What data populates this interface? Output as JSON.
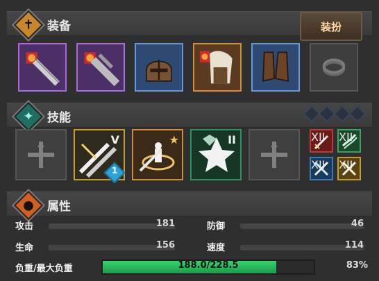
{
  "sections": {
    "equipment": {
      "title": "装备",
      "button_label": "装扮"
    },
    "skills": {
      "title": "技能",
      "skill_points_remaining": 4
    },
    "attributes": {
      "title": "属性"
    }
  },
  "equipment_slots": [
    {
      "name": "weapon-slot",
      "rarity_color": "#a86ad6"
    },
    {
      "name": "offhand-slot",
      "rarity_color": "#a86ad6"
    },
    {
      "name": "helmet-slot",
      "rarity_color": "#6a98d6"
    },
    {
      "name": "armor-slot",
      "rarity_color": "#d78b3a"
    },
    {
      "name": "boots-slot",
      "rarity_color": "#6a98d6"
    },
    {
      "name": "ring-slot",
      "rarity_color": "#585858"
    }
  ],
  "skill_slots": [
    {
      "name": "skill-empty-left"
    },
    {
      "name": "skill-slash-v",
      "level": "V",
      "badge": "1"
    },
    {
      "name": "skill-summon-star",
      "level": ""
    },
    {
      "name": "skill-burst-ii",
      "level": "II"
    },
    {
      "name": "skill-empty-right"
    }
  ],
  "mini_skills": [
    {
      "name": "mini-red-skill",
      "level": "XII"
    },
    {
      "name": "mini-green-skill",
      "level": "XII"
    },
    {
      "name": "mini-blue-skill",
      "level": "XII"
    },
    {
      "name": "mini-gold-skill",
      "level": "XII"
    }
  ],
  "stats": {
    "attack": {
      "label": "攻击",
      "value": "181"
    },
    "defense": {
      "label": "防御",
      "value": "46"
    },
    "hp": {
      "label": "生命",
      "value": "156"
    },
    "speed": {
      "label": "速度",
      "value": "114"
    },
    "weight": {
      "label": "负重/最大负重",
      "current": 188.0,
      "max": 228.5,
      "text": "188.0/228.5",
      "percent_text": "83%"
    }
  },
  "colors": {
    "weight_bar_fill": "#1e9b49"
  }
}
